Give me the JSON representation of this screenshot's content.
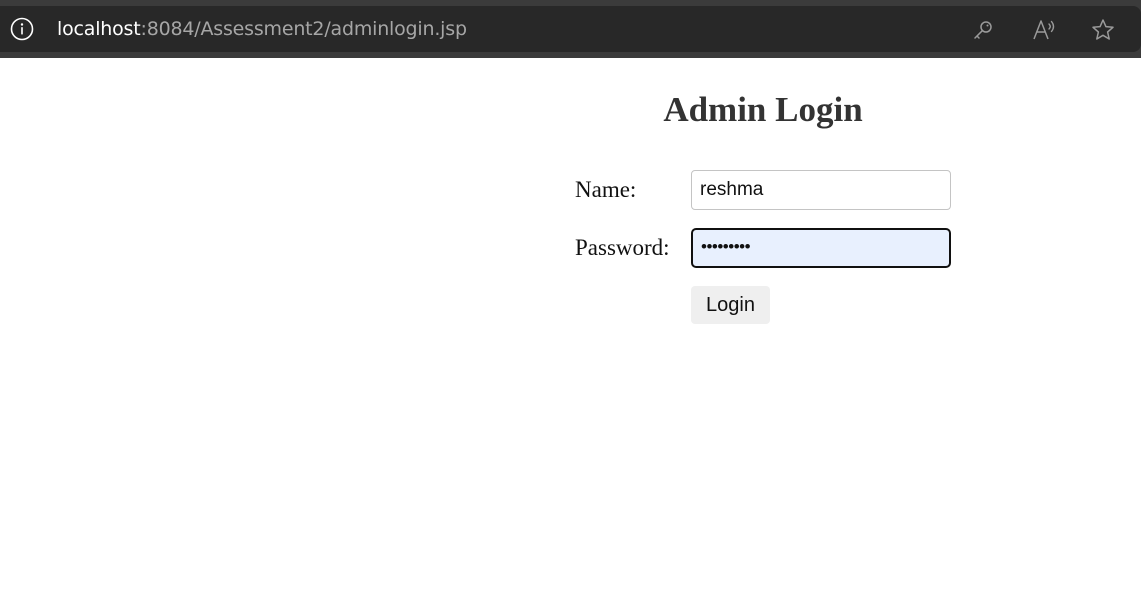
{
  "browser": {
    "url_host": "localhost",
    "url_path": ":8084/Assessment2/adminlogin.jsp",
    "icons": [
      "info-icon",
      "key-icon",
      "read-aloud-icon",
      "favorite-star-icon"
    ]
  },
  "page": {
    "title": "Admin Login",
    "name_label": "Name:",
    "name_value": "reshma",
    "password_label": "Password:",
    "password_masked": "•••••••••",
    "login_label": "Login"
  },
  "colors": {
    "chrome": "#3b3b3b",
    "address_bar": "#282828",
    "password_autofill_bg": "#e8f0fe",
    "button_bg": "#efefef"
  }
}
